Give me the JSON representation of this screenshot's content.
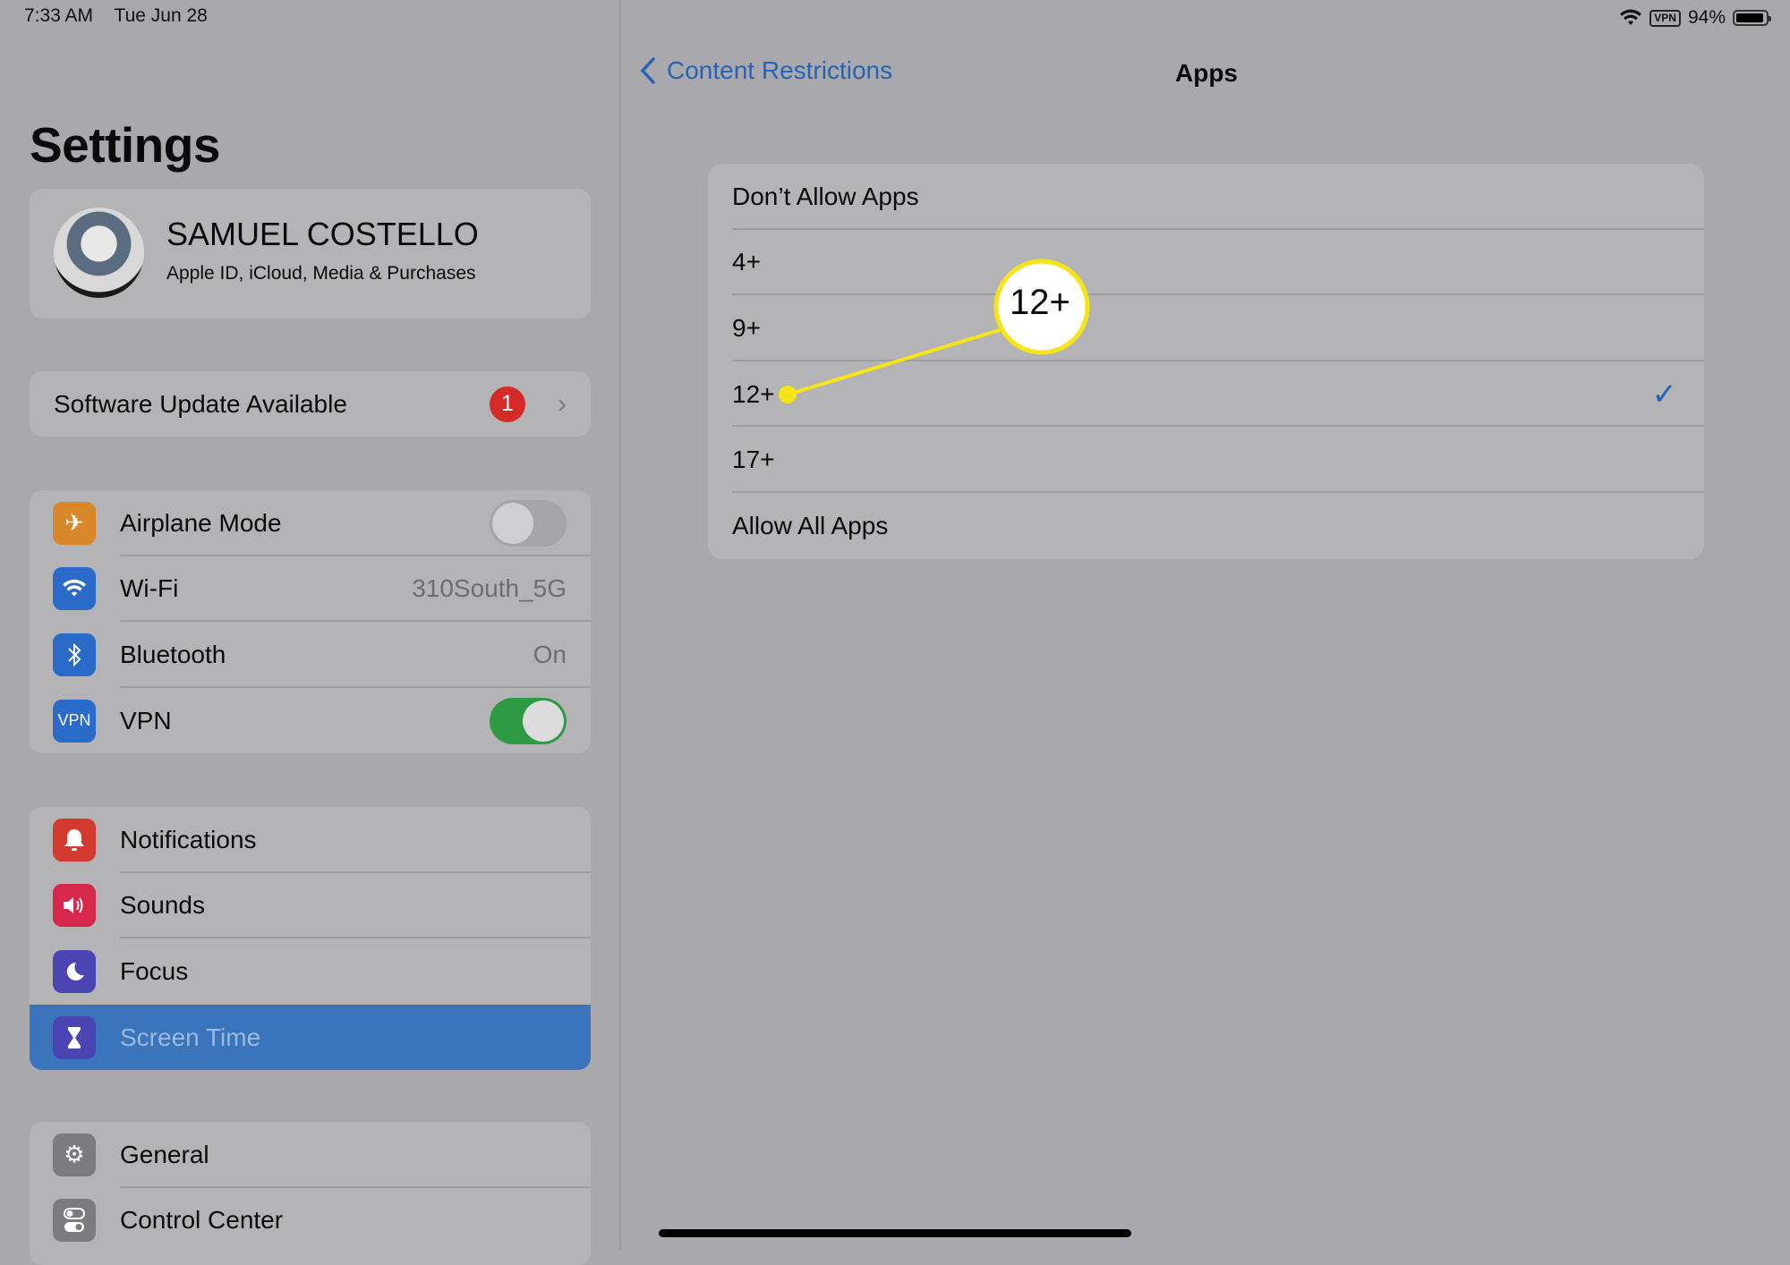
{
  "status_bar": {
    "time": "7:33 AM",
    "date": "Tue Jun 28",
    "vpn_label": "VPN",
    "battery": "94%",
    "battery_level": 0.94
  },
  "sidebar": {
    "title": "Settings",
    "profile": {
      "name": "SAMUEL COSTELLO",
      "subtitle": "Apple ID, iCloud, Media & Purchases"
    },
    "update": {
      "label": "Software Update Available",
      "badge": "1"
    },
    "connectivity": [
      {
        "label": "Airplane Mode",
        "icon": "airplane-icon",
        "color": "#d9872b",
        "toggle": false
      },
      {
        "label": "Wi-Fi",
        "icon": "wifi-icon",
        "color": "#2a6ac8",
        "value": "310South_5G"
      },
      {
        "label": "Bluetooth",
        "icon": "bluetooth-icon",
        "color": "#2a6ac8",
        "value": "On"
      },
      {
        "label": "VPN",
        "icon": "vpn-icon",
        "icon_text": "VPN",
        "color": "#2a6ac8",
        "toggle": true
      }
    ],
    "notifications_group": [
      {
        "label": "Notifications",
        "icon": "bell-icon",
        "color": "#d33a2e"
      },
      {
        "label": "Sounds",
        "icon": "speaker-icon",
        "color": "#d6284a"
      },
      {
        "label": "Focus",
        "icon": "moon-icon",
        "color": "#4b45b3"
      },
      {
        "label": "Screen Time",
        "icon": "hourglass-icon",
        "color": "#4b45b3",
        "selected": true
      }
    ],
    "general_group": [
      {
        "label": "General",
        "icon": "gear-icon",
        "color": "#7b7b80"
      },
      {
        "label": "Control Center",
        "icon": "switches-icon",
        "color": "#7b7b80"
      }
    ]
  },
  "detail": {
    "back_label": "Content Restrictions",
    "title": "Apps",
    "options": [
      {
        "label": "Don’t Allow Apps",
        "selected": false
      },
      {
        "label": "4+",
        "selected": false
      },
      {
        "label": "9+",
        "selected": false
      },
      {
        "label": "12+",
        "selected": true
      },
      {
        "label": "17+",
        "selected": false
      },
      {
        "label": "Allow All Apps",
        "selected": false
      }
    ],
    "callout": {
      "text": "12+",
      "color": "#f5e516"
    }
  }
}
